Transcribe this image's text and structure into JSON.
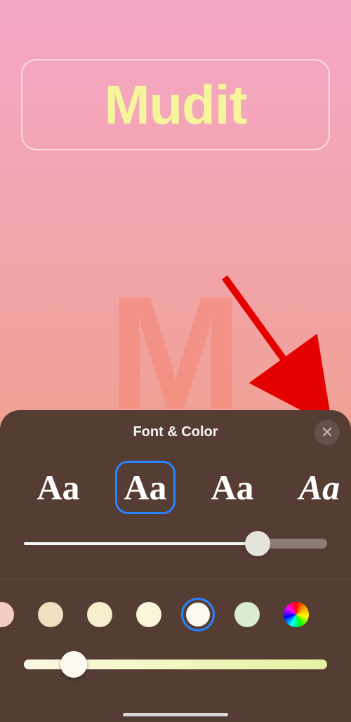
{
  "text_label": "Mudit",
  "watermark": "M",
  "panel": {
    "title": "Font & Color",
    "close_glyph": "✕",
    "fonts": {
      "sample": "Aa",
      "selected_index": 1,
      "options": [
        "sans-bold",
        "sans-rounded",
        "serif",
        "serif-italic"
      ]
    },
    "size_slider": {
      "value": 0.75
    },
    "colors": {
      "selected_index": 4,
      "swatches": [
        "#f1cdbf",
        "#f3dec2",
        "#f7eecd",
        "#faf6db",
        "#fcfaf0",
        "#d9ecd2",
        "rainbow"
      ]
    },
    "tint_slider": {
      "value": 0.14
    }
  },
  "annotation": {
    "target": "close-button"
  }
}
